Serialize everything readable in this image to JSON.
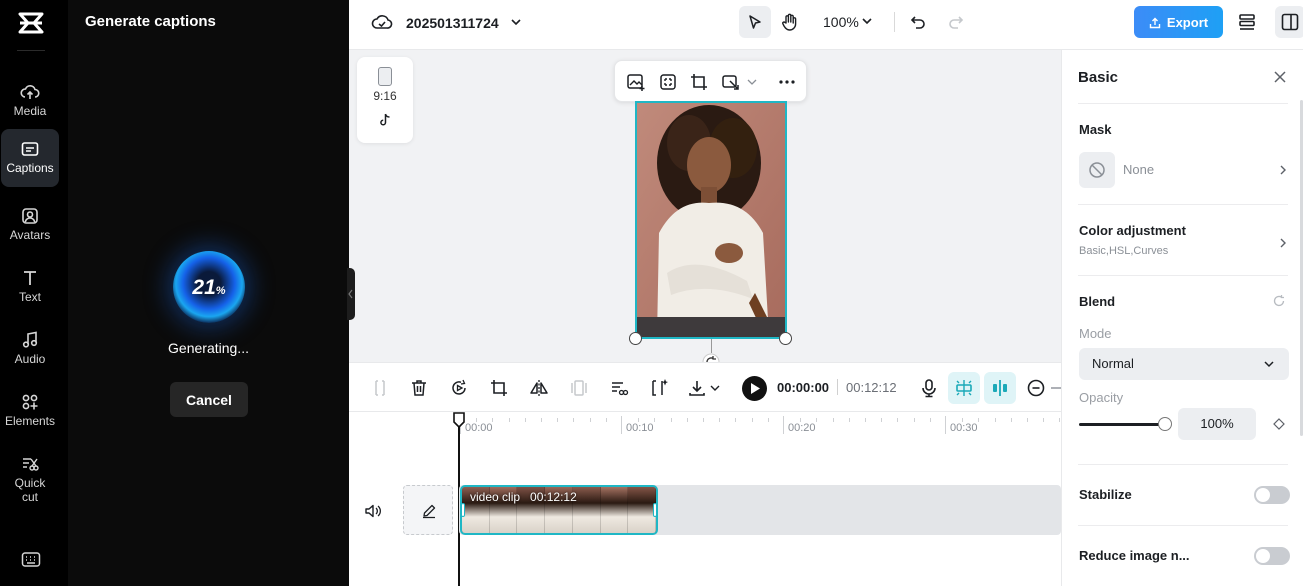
{
  "nav": {
    "items": [
      {
        "label": "Media",
        "icon": "cloud-upload-icon"
      },
      {
        "label": "Captions",
        "icon": "captions-icon",
        "active": true
      },
      {
        "label": "Avatars",
        "icon": "avatar-icon"
      },
      {
        "label": "Text",
        "icon": "text-icon"
      },
      {
        "label": "Audio",
        "icon": "music-note-icon"
      },
      {
        "label": "Elements",
        "icon": "elements-icon"
      },
      {
        "label": "Quick cut",
        "icon": "quick-cut-icon"
      }
    ]
  },
  "caption_panel": {
    "title": "Generate captions",
    "progress_value": "21",
    "progress_unit": "%",
    "status": "Generating...",
    "cancel_label": "Cancel"
  },
  "topbar": {
    "project_name": "202501311724",
    "zoom": "100%",
    "export_label": "Export",
    "accent": "#2f95f6"
  },
  "canvas": {
    "aspect_ratio": "9:16",
    "platform_icon": "tiktok-icon"
  },
  "timeline": {
    "current_time": "00:00:00",
    "total_time": "00:12:12",
    "ruler_labels": [
      "00:00",
      "00:10",
      "00:20",
      "00:30"
    ],
    "clip_name": "video clip",
    "clip_duration": "00:12:12",
    "clip_color": "#1fb7c5"
  },
  "props": {
    "title": "Basic",
    "mask_label": "Mask",
    "mask_value": "None",
    "color_adj_label": "Color adjustment",
    "color_adj_sub": "Basic,HSL,Curves",
    "blend_label": "Blend",
    "mode_label": "Mode",
    "mode_value": "Normal",
    "opacity_label": "Opacity",
    "opacity_value": "100%",
    "opacity_level": 1.0,
    "stabilize_label": "Stabilize",
    "stabilize_on": false,
    "reduce_noise_label": "Reduce image n...",
    "reduce_noise_on": false
  }
}
